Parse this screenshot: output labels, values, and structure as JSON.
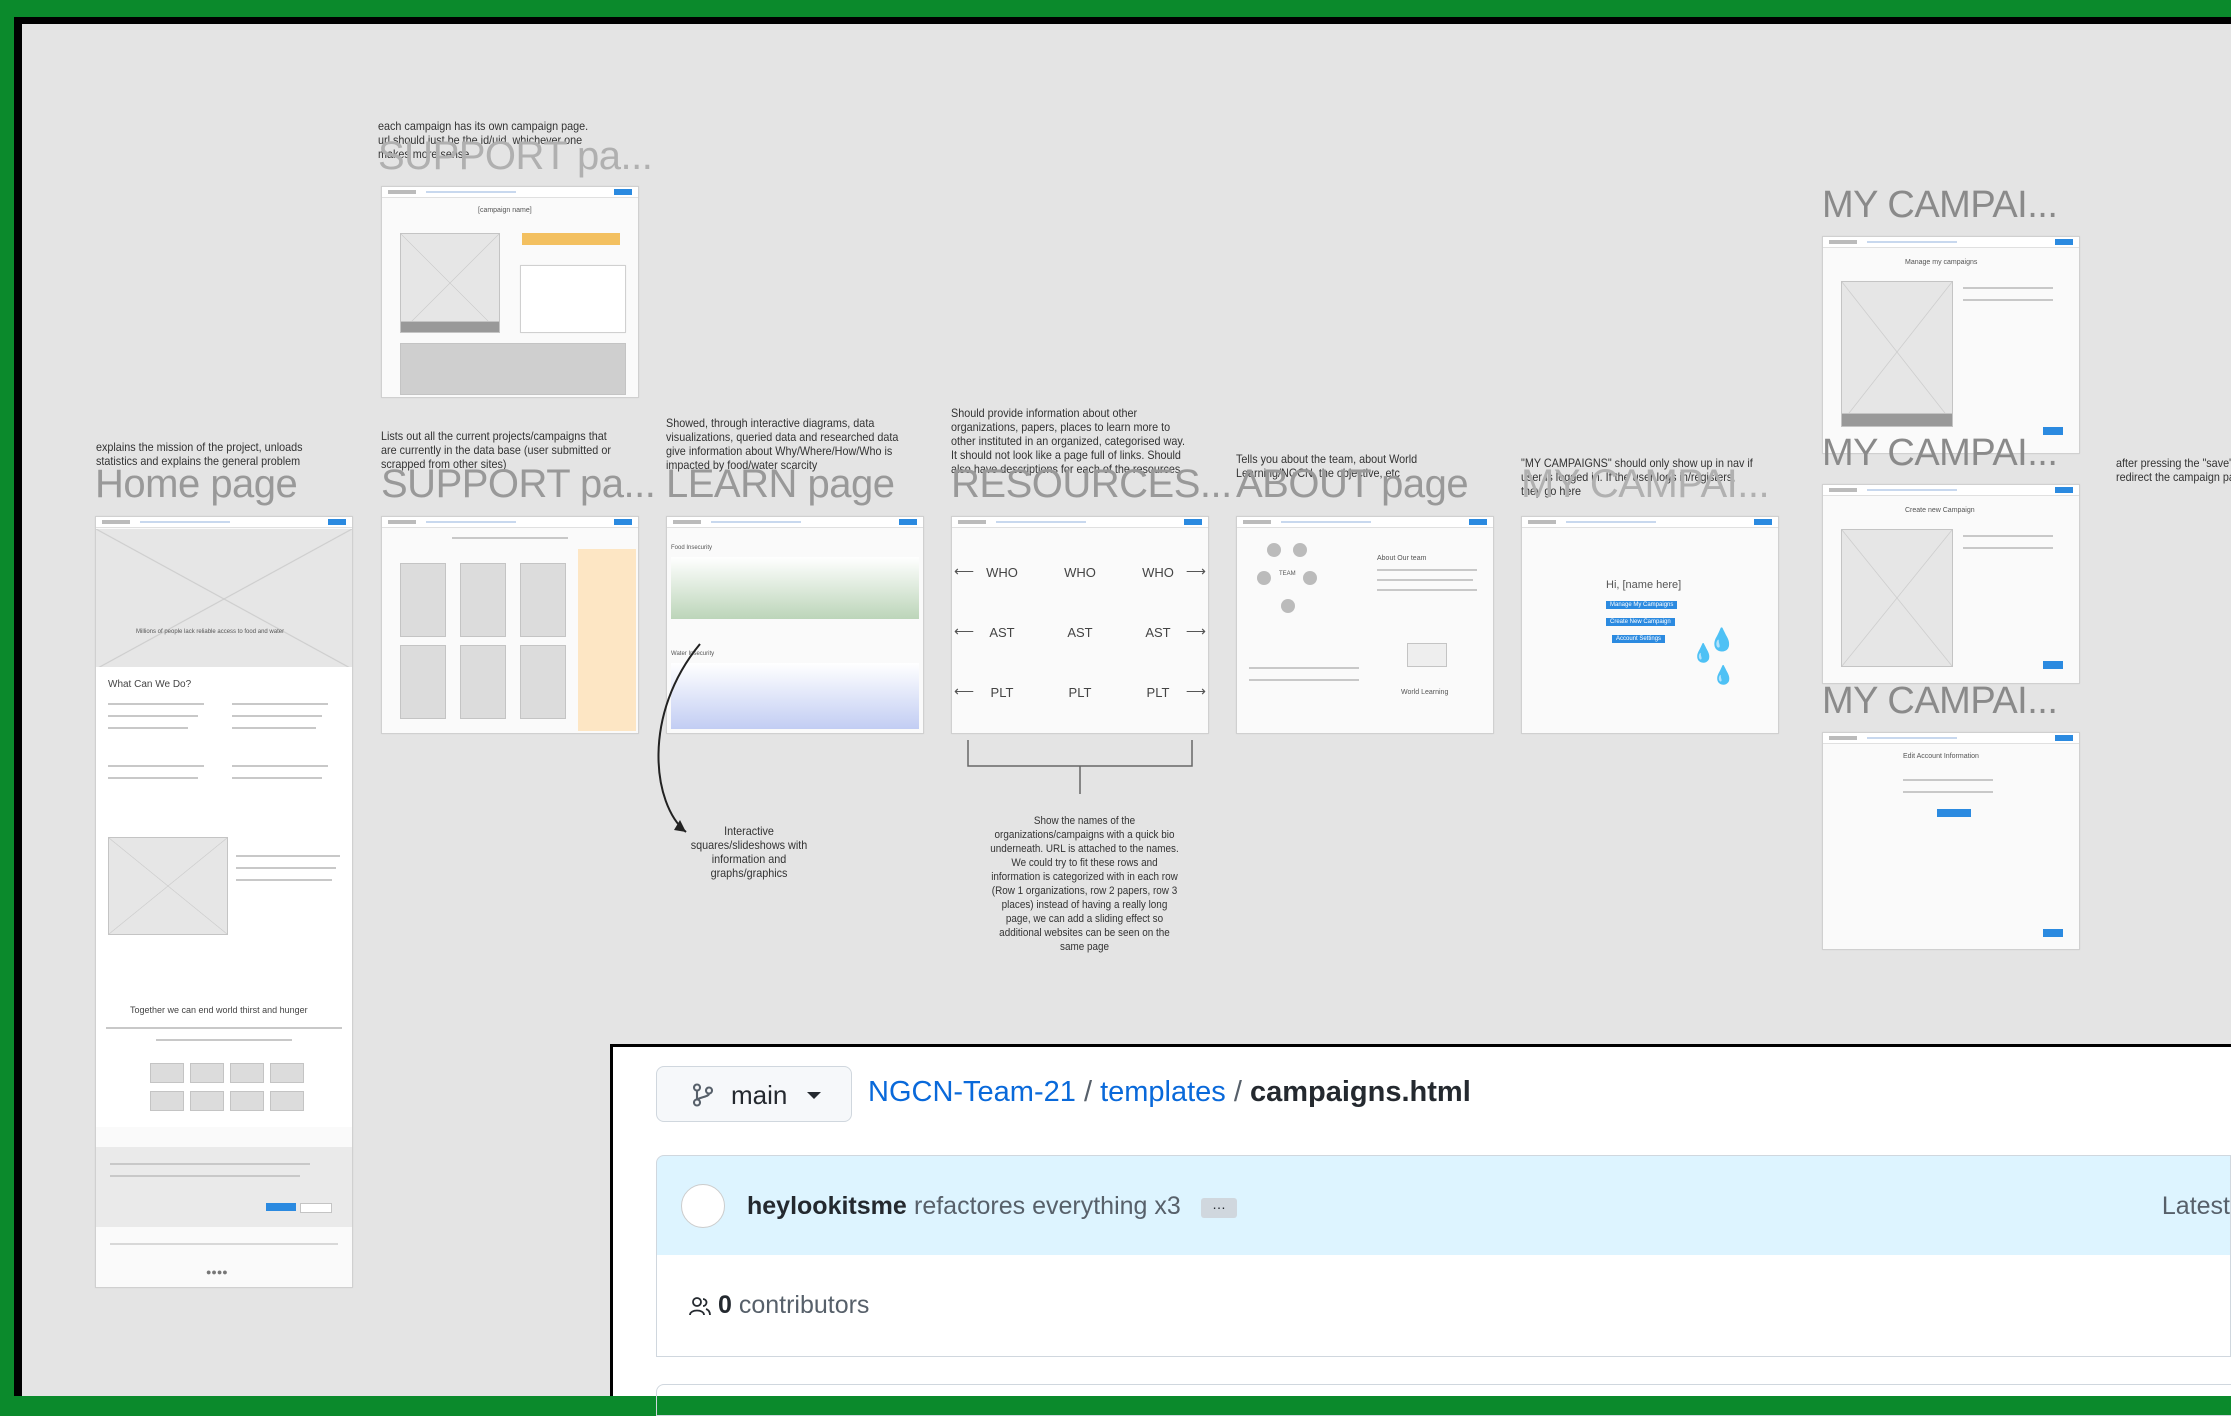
{
  "notes": {
    "support_campaign": "each campaign has its own campaign page. url should just be the id/uid, whichever one makes more sense",
    "home": "explains the mission of the project, unloads statistics and explains the general problem",
    "support": "Lists out all the current projects/campaigns that are currently in the data base (user submitted or scrapped from other sites)",
    "learn": "Showed, through interactive diagrams, data visualizations, queried data and researched data give information about Why/Where/How/Who is impacted by food/water scarcity",
    "resources": "Should provide information about other organizations, papers, places to learn more to other instituted in an organized, categorised way. It should not look like a page full of links. Should also have descriptions for each of the resources",
    "about": "Tells you about the team, about World Learning/NGCN, the objective, etc",
    "my_campaigns": "\"MY CAMPAIGNS\" should only show up in nav if user is logged in. If the user logs in/registers, they go here",
    "after_save": "after pressing the \"save\" site should redirect the campaign page",
    "interactive": "Interactive squares/slideshows with information and graphs/graphics",
    "show_names": "Show the names of the organizations/campaigns with a quick bio underneath. URL is attached to the names. We could try to fit these rows and information is categorized with in each row (Row 1 organizations, row 2 papers, row 3 places) instead of having a really long page, we can add a sliding effect so additional websites can be seen on the same page"
  },
  "frame_titles": {
    "support_top": "SUPPORT pa...",
    "home": "Home page",
    "support": "SUPPORT pa...",
    "learn": "LEARN page",
    "resources": "RESOURCES...",
    "about": "ABOUT page",
    "my_campaigns_mid": "MY CAMPAI...",
    "my_campaigns_1": "MY CAMPAI...",
    "my_campaigns_2": "MY CAMPAI...",
    "my_campaigns_3": "MY CAMPAI..."
  },
  "wire": {
    "campaign_name": "[campaign name]",
    "what_can_we_do": "What Can We Do?",
    "together": "Together we can end world thirst and hunger",
    "hi_name": "Hi, [name here]",
    "manage_campaigns": "Manage My Campaigns",
    "create_campaign": "Create New Campaign",
    "account_settings": "Account Settings",
    "manage_title": "Manage my campaigns",
    "create_title": "Create new Campaign",
    "edit_title": "Edit Account Information",
    "team": "TEAM",
    "about_us": "About Our team",
    "world_learning": "World Learning",
    "who": "WHO",
    "ast": "AST",
    "plt": "PLT",
    "food_insecurity": "Food Insecurity",
    "water_insecurity": "Water Insecurity",
    "home_caption": "Millions of people lack reliable access to food and water"
  },
  "github": {
    "branch": "main",
    "repo": "NGCN-Team-21",
    "sep": "/",
    "folder": "templates",
    "file": "campaigns.html",
    "author": "heylookitsme",
    "commit_message": "refactores everything x3",
    "ellipsis": "…",
    "latest": "Latest",
    "contributors_count": "0",
    "contributors_label": "contributors"
  }
}
